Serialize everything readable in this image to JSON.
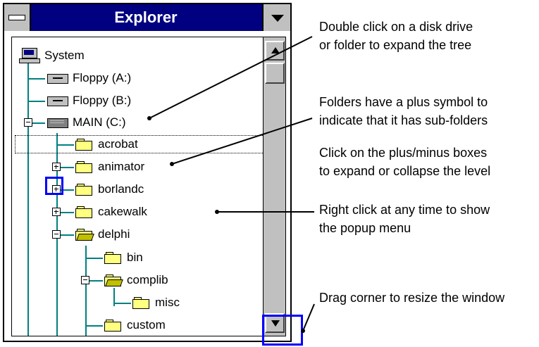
{
  "window": {
    "title": "Explorer"
  },
  "tree": {
    "root": "System",
    "items": [
      {
        "label": "Floppy (A:)"
      },
      {
        "label": "Floppy (B:)"
      },
      {
        "label": "MAIN (C:)"
      },
      {
        "label": "acrobat"
      },
      {
        "label": "animator"
      },
      {
        "label": "borlandc"
      },
      {
        "label": "cakewalk"
      },
      {
        "label": "delphi"
      },
      {
        "label": "bin"
      },
      {
        "label": "complib"
      },
      {
        "label": "misc"
      },
      {
        "label": "custom"
      }
    ]
  },
  "annotations": {
    "expand": [
      "Double click on a disk drive",
      "or folder to expand the tree"
    ],
    "plus": [
      "Folders have a plus symbol to",
      "indicate that it has sub-folders"
    ],
    "boxes": [
      "Click on the plus/minus boxes",
      "to expand or collapse the level"
    ],
    "popup": [
      "Right click at any time to show",
      "the popup menu"
    ],
    "resize": [
      "Drag corner to resize the window"
    ]
  },
  "colors": {
    "titlebar": "#000080",
    "tree_lines": "#008080",
    "highlight": "#0000ff"
  }
}
